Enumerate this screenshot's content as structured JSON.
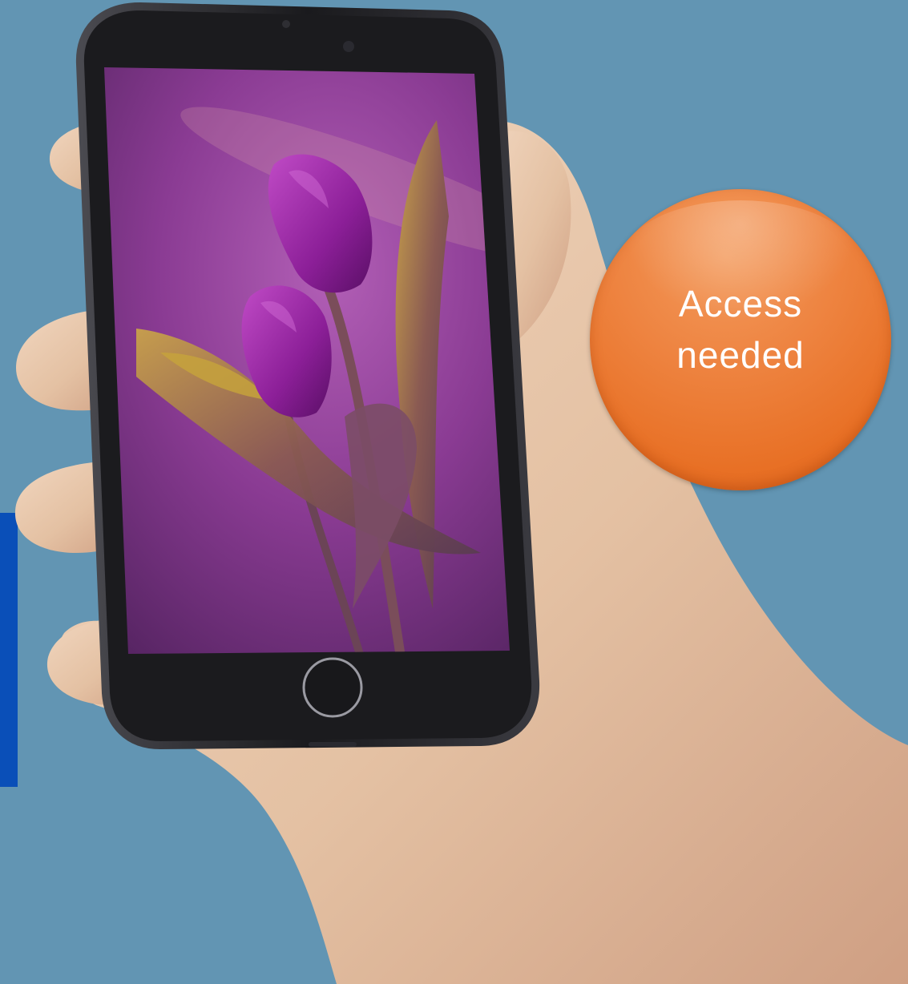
{
  "badge": {
    "line1": "Access",
    "line2": "needed"
  },
  "colors": {
    "background": "#6295b3",
    "accent_bar": "#0a4fb8",
    "badge": "#ee8036",
    "phone_body": "#1b1b1e",
    "skin": "#e6c4a6",
    "screen": "#7a2e86"
  },
  "icons": [
    "home-button-icon",
    "front-camera-icon",
    "earpiece-icon"
  ]
}
